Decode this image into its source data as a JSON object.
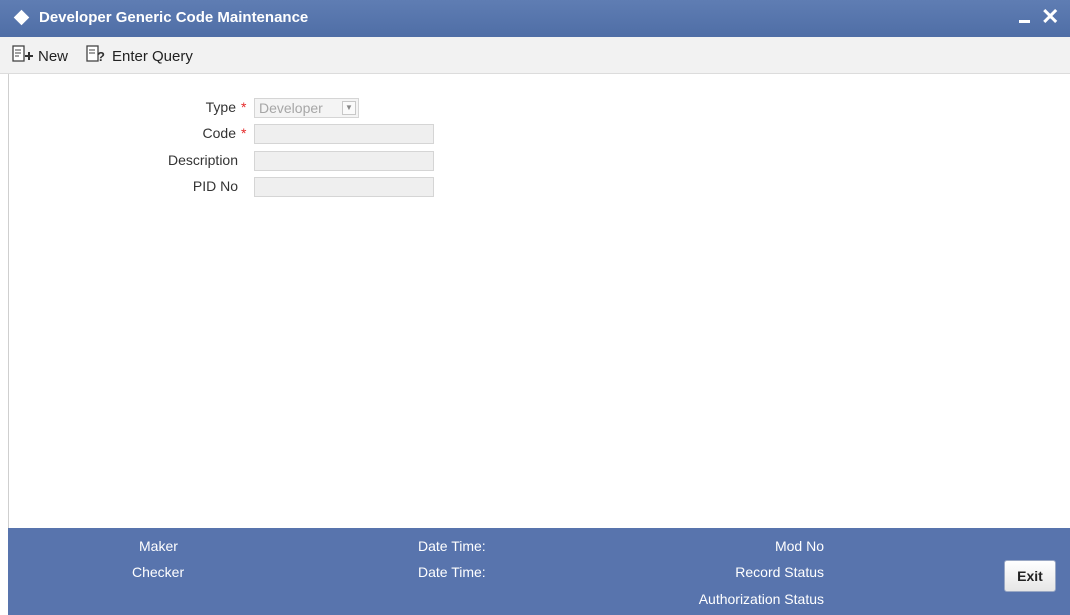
{
  "window": {
    "title": "Developer Generic Code Maintenance",
    "minimize_glyph": "_",
    "close_glyph": "✕"
  },
  "toolbar": {
    "new_label": "New",
    "new_icon": "new-record-icon",
    "enter_query_label": "Enter Query",
    "enter_query_icon": "query-icon"
  },
  "form": {
    "type_label": "Type",
    "type_value": "Developer",
    "code_label": "Code",
    "code_value": "",
    "description_label": "Description",
    "description_value": "",
    "pid_label": "PID No",
    "pid_value": "",
    "required_marker": "*"
  },
  "footer": {
    "maker_label": "Maker",
    "checker_label": "Checker",
    "maker_datetime_label": "Date Time:",
    "checker_datetime_label": "Date Time:",
    "mod_no_label": "Mod No",
    "record_status_label": "Record Status",
    "authorization_status_label": "Authorization Status",
    "exit_label": "Exit"
  },
  "colors": {
    "titlebar": "#5874ad",
    "footer": "#5874ad",
    "required": "#e52a2a"
  }
}
